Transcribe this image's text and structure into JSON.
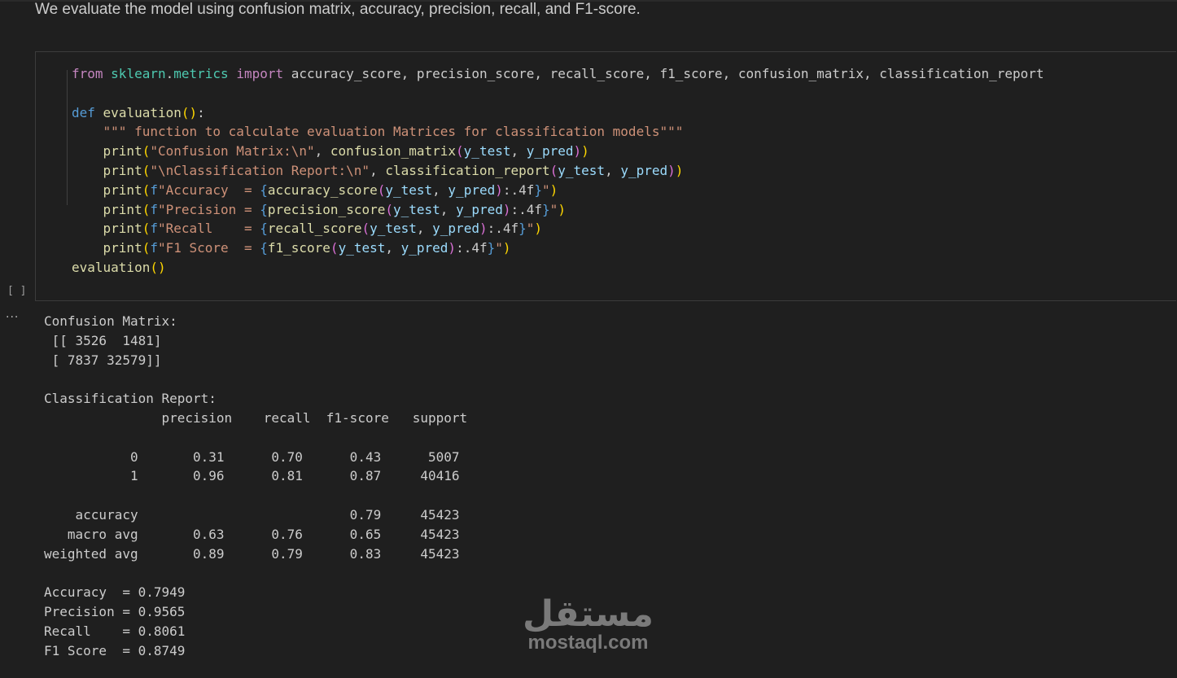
{
  "markdown": {
    "text": "We evaluate the model using confusion matrix, accuracy, precision, recall, and F1-score."
  },
  "code_cell": {
    "execution_count": "[ ]",
    "lines": [
      [
        {
          "t": "from",
          "c": "kw"
        },
        {
          "t": " ",
          "c": "plain"
        },
        {
          "t": "sklearn",
          "c": "mod"
        },
        {
          "t": ".",
          "c": "plain"
        },
        {
          "t": "metrics",
          "c": "mod"
        },
        {
          "t": " ",
          "c": "plain"
        },
        {
          "t": "import",
          "c": "kw"
        },
        {
          "t": " accuracy_score, precision_score, recall_score, f1_score, confusion_matrix, classification_report",
          "c": "plain"
        }
      ],
      [],
      [
        {
          "t": "def",
          "c": "kw2"
        },
        {
          "t": " ",
          "c": "plain"
        },
        {
          "t": "evaluation",
          "c": "fn"
        },
        {
          "t": "()",
          "c": "p1"
        },
        {
          "t": ":",
          "c": "plain"
        }
      ],
      [
        {
          "t": "    ",
          "c": "plain"
        },
        {
          "t": "\"\"\" function to calculate evaluation Matrices for classification models\"\"\"",
          "c": "str"
        }
      ],
      [
        {
          "t": "    ",
          "c": "plain"
        },
        {
          "t": "print",
          "c": "fn"
        },
        {
          "t": "(",
          "c": "p1"
        },
        {
          "t": "\"Confusion Matrix:\\n\"",
          "c": "str"
        },
        {
          "t": ", ",
          "c": "plain"
        },
        {
          "t": "confusion_matrix",
          "c": "fn"
        },
        {
          "t": "(",
          "c": "p2"
        },
        {
          "t": "y_test",
          "c": "var"
        },
        {
          "t": ", ",
          "c": "plain"
        },
        {
          "t": "y_pred",
          "c": "var"
        },
        {
          "t": ")",
          "c": "p2"
        },
        {
          "t": ")",
          "c": "p1"
        }
      ],
      [
        {
          "t": "    ",
          "c": "plain"
        },
        {
          "t": "print",
          "c": "fn"
        },
        {
          "t": "(",
          "c": "p1"
        },
        {
          "t": "\"\\nClassification Report:\\n\"",
          "c": "str"
        },
        {
          "t": ", ",
          "c": "plain"
        },
        {
          "t": "classification_report",
          "c": "fn"
        },
        {
          "t": "(",
          "c": "p2"
        },
        {
          "t": "y_test",
          "c": "var"
        },
        {
          "t": ", ",
          "c": "plain"
        },
        {
          "t": "y_pred",
          "c": "var"
        },
        {
          "t": ")",
          "c": "p2"
        },
        {
          "t": ")",
          "c": "p1"
        }
      ],
      [
        {
          "t": "    ",
          "c": "plain"
        },
        {
          "t": "print",
          "c": "fn"
        },
        {
          "t": "(",
          "c": "p1"
        },
        {
          "t": "f",
          "c": "kw2"
        },
        {
          "t": "\"Accuracy  = ",
          "c": "str"
        },
        {
          "t": "{",
          "c": "kw2"
        },
        {
          "t": "accuracy_score",
          "c": "fn"
        },
        {
          "t": "(",
          "c": "p2"
        },
        {
          "t": "y_test",
          "c": "var"
        },
        {
          "t": ", ",
          "c": "plain"
        },
        {
          "t": "y_pred",
          "c": "var"
        },
        {
          "t": ")",
          "c": "p2"
        },
        {
          "t": ":.4f",
          "c": "plain"
        },
        {
          "t": "}",
          "c": "kw2"
        },
        {
          "t": "\"",
          "c": "str"
        },
        {
          "t": ")",
          "c": "p1"
        }
      ],
      [
        {
          "t": "    ",
          "c": "plain"
        },
        {
          "t": "print",
          "c": "fn"
        },
        {
          "t": "(",
          "c": "p1"
        },
        {
          "t": "f",
          "c": "kw2"
        },
        {
          "t": "\"Precision = ",
          "c": "str"
        },
        {
          "t": "{",
          "c": "kw2"
        },
        {
          "t": "precision_score",
          "c": "fn"
        },
        {
          "t": "(",
          "c": "p2"
        },
        {
          "t": "y_test",
          "c": "var"
        },
        {
          "t": ", ",
          "c": "plain"
        },
        {
          "t": "y_pred",
          "c": "var"
        },
        {
          "t": ")",
          "c": "p2"
        },
        {
          "t": ":.4f",
          "c": "plain"
        },
        {
          "t": "}",
          "c": "kw2"
        },
        {
          "t": "\"",
          "c": "str"
        },
        {
          "t": ")",
          "c": "p1"
        }
      ],
      [
        {
          "t": "    ",
          "c": "plain"
        },
        {
          "t": "print",
          "c": "fn"
        },
        {
          "t": "(",
          "c": "p1"
        },
        {
          "t": "f",
          "c": "kw2"
        },
        {
          "t": "\"Recall    = ",
          "c": "str"
        },
        {
          "t": "{",
          "c": "kw2"
        },
        {
          "t": "recall_score",
          "c": "fn"
        },
        {
          "t": "(",
          "c": "p2"
        },
        {
          "t": "y_test",
          "c": "var"
        },
        {
          "t": ", ",
          "c": "plain"
        },
        {
          "t": "y_pred",
          "c": "var"
        },
        {
          "t": ")",
          "c": "p2"
        },
        {
          "t": ":.4f",
          "c": "plain"
        },
        {
          "t": "}",
          "c": "kw2"
        },
        {
          "t": "\"",
          "c": "str"
        },
        {
          "t": ")",
          "c": "p1"
        }
      ],
      [
        {
          "t": "    ",
          "c": "plain"
        },
        {
          "t": "print",
          "c": "fn"
        },
        {
          "t": "(",
          "c": "p1"
        },
        {
          "t": "f",
          "c": "kw2"
        },
        {
          "t": "\"F1 Score  = ",
          "c": "str"
        },
        {
          "t": "{",
          "c": "kw2"
        },
        {
          "t": "f1_score",
          "c": "fn"
        },
        {
          "t": "(",
          "c": "p2"
        },
        {
          "t": "y_test",
          "c": "var"
        },
        {
          "t": ", ",
          "c": "plain"
        },
        {
          "t": "y_pred",
          "c": "var"
        },
        {
          "t": ")",
          "c": "p2"
        },
        {
          "t": ":.4f",
          "c": "plain"
        },
        {
          "t": "}",
          "c": "kw2"
        },
        {
          "t": "\"",
          "c": "str"
        },
        {
          "t": ")",
          "c": "p1"
        }
      ],
      [
        {
          "t": "evaluation",
          "c": "fn"
        },
        {
          "t": "()",
          "c": "p1"
        }
      ]
    ]
  },
  "output": {
    "ellipsis": "···",
    "lines": [
      "Confusion Matrix:",
      " [[ 3526  1481]",
      " [ 7837 32579]]",
      "",
      "Classification Report:",
      "               precision    recall  f1-score   support",
      "",
      "           0       0.31      0.70      0.43      5007",
      "           1       0.96      0.81      0.87     40416",
      "",
      "    accuracy                           0.79     45423",
      "   macro avg       0.63      0.76      0.65     45423",
      "weighted avg       0.89      0.79      0.83     45423",
      "",
      "Accuracy  = 0.7949",
      "Precision = 0.9565",
      "Recall    = 0.8061",
      "F1 Score  = 0.8749"
    ]
  },
  "watermark": {
    "logo_text": "مستقل",
    "domain": "mostaql.com"
  }
}
